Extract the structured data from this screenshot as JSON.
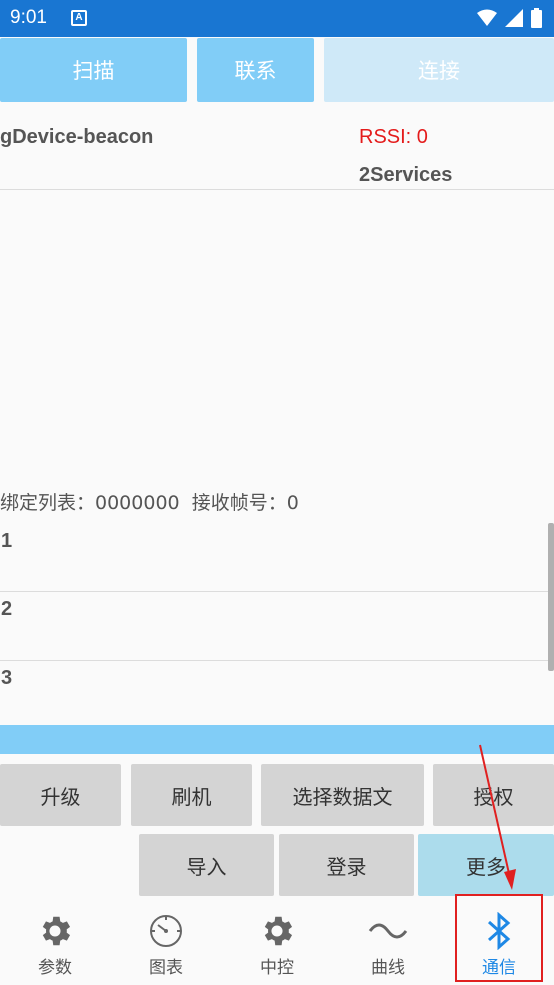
{
  "status_bar": {
    "time": "9:01",
    "notification_glyph": "A"
  },
  "top_buttons": [
    {
      "label": "扫描"
    },
    {
      "label": "联系"
    },
    {
      "label": "连接"
    }
  ],
  "device": {
    "name": "gDevice-beacon",
    "rssi": "RSSI: 0",
    "services": "2Services"
  },
  "binding_info": "绑定列表：0000000  接收帧号：0",
  "rows": [
    "1",
    "2",
    "3"
  ],
  "action_buttons_row1": [
    {
      "label": "升级"
    },
    {
      "label": "刷机"
    },
    {
      "label": "选择数据文"
    },
    {
      "label": "授权"
    }
  ],
  "action_buttons_row2": [
    {
      "label": "导入"
    },
    {
      "label": "登录"
    },
    {
      "label": "更多"
    }
  ],
  "bottom_nav": [
    {
      "label": "参数",
      "icon": "gear-icon"
    },
    {
      "label": "图表",
      "icon": "dial-icon"
    },
    {
      "label": "中控",
      "icon": "gear-icon"
    },
    {
      "label": "曲线",
      "icon": "wave-icon"
    },
    {
      "label": "通信",
      "icon": "bluetooth-icon",
      "active": true
    }
  ],
  "colors": {
    "status_bar": "#1976d2",
    "accent_button": "#81cdf7",
    "rssi": "#e41b1b",
    "active_nav": "#1e88e5",
    "highlight": "#e02020"
  }
}
